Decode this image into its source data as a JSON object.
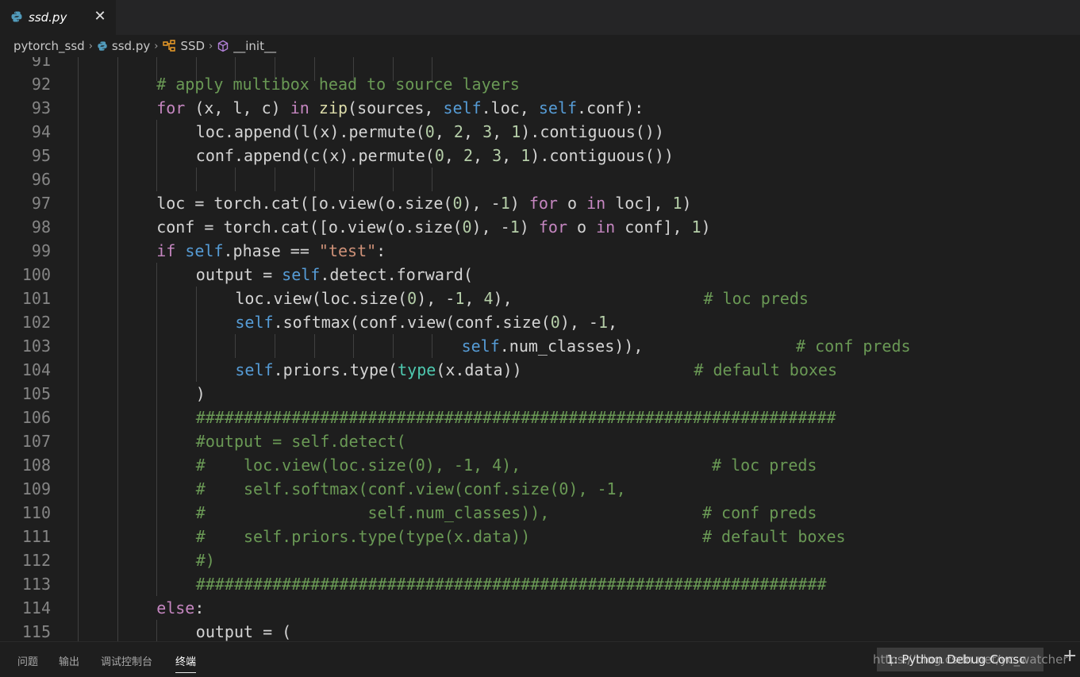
{
  "tab": {
    "label": "ssd.py",
    "close": "✕"
  },
  "breadcrumb": {
    "items": [
      "pytorch_ssd",
      "ssd.py",
      "SSD",
      "__init__"
    ],
    "separator": "›"
  },
  "colors": {
    "keyword": "#c586c0",
    "self": "#569cd6",
    "builtin": "#4ec9b0",
    "string": "#ce9178",
    "number": "#b5cea8",
    "comment": "#6a9955",
    "function": "#dcdcaa",
    "plain": "#d4d4d4"
  },
  "code_lines": [
    {
      "num": "91",
      "indent": 0,
      "tokens": []
    },
    {
      "num": "92",
      "indent": 8,
      "tokens": [
        [
          "c",
          "# apply multibox head to source layers"
        ]
      ]
    },
    {
      "num": "93",
      "indent": 8,
      "tokens": [
        [
          "k",
          "for"
        ],
        [
          "p",
          " (x, l, c) "
        ],
        [
          "k",
          "in"
        ],
        [
          "p",
          " "
        ],
        [
          "f",
          "zip"
        ],
        [
          "p",
          "(sources, "
        ],
        [
          "s",
          "self"
        ],
        [
          "p",
          ".loc, "
        ],
        [
          "s",
          "self"
        ],
        [
          "p",
          ".conf):"
        ]
      ]
    },
    {
      "num": "94",
      "indent": 12,
      "tokens": [
        [
          "p",
          "loc.append(l(x).permute("
        ],
        [
          "n",
          "0"
        ],
        [
          "p",
          ", "
        ],
        [
          "n",
          "2"
        ],
        [
          "p",
          ", "
        ],
        [
          "n",
          "3"
        ],
        [
          "p",
          ", "
        ],
        [
          "n",
          "1"
        ],
        [
          "p",
          ").contiguous())"
        ]
      ]
    },
    {
      "num": "95",
      "indent": 12,
      "tokens": [
        [
          "p",
          "conf.append(c(x).permute("
        ],
        [
          "n",
          "0"
        ],
        [
          "p",
          ", "
        ],
        [
          "n",
          "2"
        ],
        [
          "p",
          ", "
        ],
        [
          "n",
          "3"
        ],
        [
          "p",
          ", "
        ],
        [
          "n",
          "1"
        ],
        [
          "p",
          ").contiguous())"
        ]
      ]
    },
    {
      "num": "96",
      "indent": 0,
      "tokens": []
    },
    {
      "num": "97",
      "indent": 8,
      "tokens": [
        [
          "p",
          "loc = torch.cat([o.view(o.size("
        ],
        [
          "n",
          "0"
        ],
        [
          "p",
          "), -"
        ],
        [
          "n",
          "1"
        ],
        [
          "p",
          ") "
        ],
        [
          "k",
          "for"
        ],
        [
          "p",
          " o "
        ],
        [
          "k",
          "in"
        ],
        [
          "p",
          " loc], "
        ],
        [
          "n",
          "1"
        ],
        [
          "p",
          ")"
        ]
      ]
    },
    {
      "num": "98",
      "indent": 8,
      "tokens": [
        [
          "p",
          "conf = torch.cat([o.view(o.size("
        ],
        [
          "n",
          "0"
        ],
        [
          "p",
          "), -"
        ],
        [
          "n",
          "1"
        ],
        [
          "p",
          ") "
        ],
        [
          "k",
          "for"
        ],
        [
          "p",
          " o "
        ],
        [
          "k",
          "in"
        ],
        [
          "p",
          " conf], "
        ],
        [
          "n",
          "1"
        ],
        [
          "p",
          ")"
        ]
      ]
    },
    {
      "num": "99",
      "indent": 8,
      "tokens": [
        [
          "k",
          "if"
        ],
        [
          "p",
          " "
        ],
        [
          "s",
          "self"
        ],
        [
          "p",
          ".phase == "
        ],
        [
          "t",
          "\"test\""
        ],
        [
          "p",
          ":"
        ]
      ]
    },
    {
      "num": "100",
      "indent": 12,
      "tokens": [
        [
          "p",
          "output = "
        ],
        [
          "s",
          "self"
        ],
        [
          "p",
          ".detect.forward("
        ]
      ]
    },
    {
      "num": "101",
      "indent": 16,
      "tokens": [
        [
          "p",
          "loc.view(loc.size("
        ],
        [
          "n",
          "0"
        ],
        [
          "p",
          "), -"
        ],
        [
          "n",
          "1"
        ],
        [
          "p",
          ", "
        ],
        [
          "n",
          "4"
        ],
        [
          "p",
          "),                    "
        ],
        [
          "c",
          "# loc preds"
        ]
      ]
    },
    {
      "num": "102",
      "indent": 16,
      "tokens": [
        [
          "s",
          "self"
        ],
        [
          "p",
          ".softmax(conf.view(conf.size("
        ],
        [
          "n",
          "0"
        ],
        [
          "p",
          "), -"
        ],
        [
          "n",
          "1"
        ],
        [
          "p",
          ","
        ]
      ]
    },
    {
      "num": "103",
      "indent": 39,
      "tokens": [
        [
          "s",
          "self"
        ],
        [
          "p",
          ".num_classes)),                "
        ],
        [
          "c",
          "# conf preds"
        ]
      ]
    },
    {
      "num": "104",
      "indent": 16,
      "tokens": [
        [
          "s",
          "self"
        ],
        [
          "p",
          ".priors.type("
        ],
        [
          "b",
          "type"
        ],
        [
          "p",
          "(x.data))                  "
        ],
        [
          "c",
          "# default boxes"
        ]
      ]
    },
    {
      "num": "105",
      "indent": 12,
      "tokens": [
        [
          "p",
          ")"
        ]
      ]
    },
    {
      "num": "106",
      "indent": 12,
      "tokens": [
        [
          "c",
          "###################################################################"
        ]
      ]
    },
    {
      "num": "107",
      "indent": 12,
      "tokens": [
        [
          "c",
          "#output = self.detect("
        ]
      ]
    },
    {
      "num": "108",
      "indent": 12,
      "tokens": [
        [
          "c",
          "#    loc.view(loc.size(0), -1, 4),                    # loc preds"
        ]
      ]
    },
    {
      "num": "109",
      "indent": 12,
      "tokens": [
        [
          "c",
          "#    self.softmax(conf.view(conf.size(0), -1,"
        ]
      ]
    },
    {
      "num": "110",
      "indent": 12,
      "tokens": [
        [
          "c",
          "#                 self.num_classes)),                # conf preds"
        ]
      ]
    },
    {
      "num": "111",
      "indent": 12,
      "tokens": [
        [
          "c",
          "#    self.priors.type(type(x.data))                  # default boxes"
        ]
      ]
    },
    {
      "num": "112",
      "indent": 12,
      "tokens": [
        [
          "c",
          "#)"
        ]
      ]
    },
    {
      "num": "113",
      "indent": 12,
      "tokens": [
        [
          "c",
          "##################################################################"
        ]
      ]
    },
    {
      "num": "114",
      "indent": 8,
      "tokens": [
        [
          "k",
          "else"
        ],
        [
          "p",
          ":"
        ]
      ]
    },
    {
      "num": "115",
      "indent": 12,
      "tokens": [
        [
          "p",
          "output = ("
        ]
      ]
    }
  ],
  "panel": {
    "tabs": [
      "问题",
      "输出",
      "调试控制台",
      "终端"
    ],
    "active_tab": "终端",
    "terminal_select": "1: Python Debug Consc",
    "add": "+"
  },
  "watermark": "https://blog.csdn.net/yc_watcher"
}
